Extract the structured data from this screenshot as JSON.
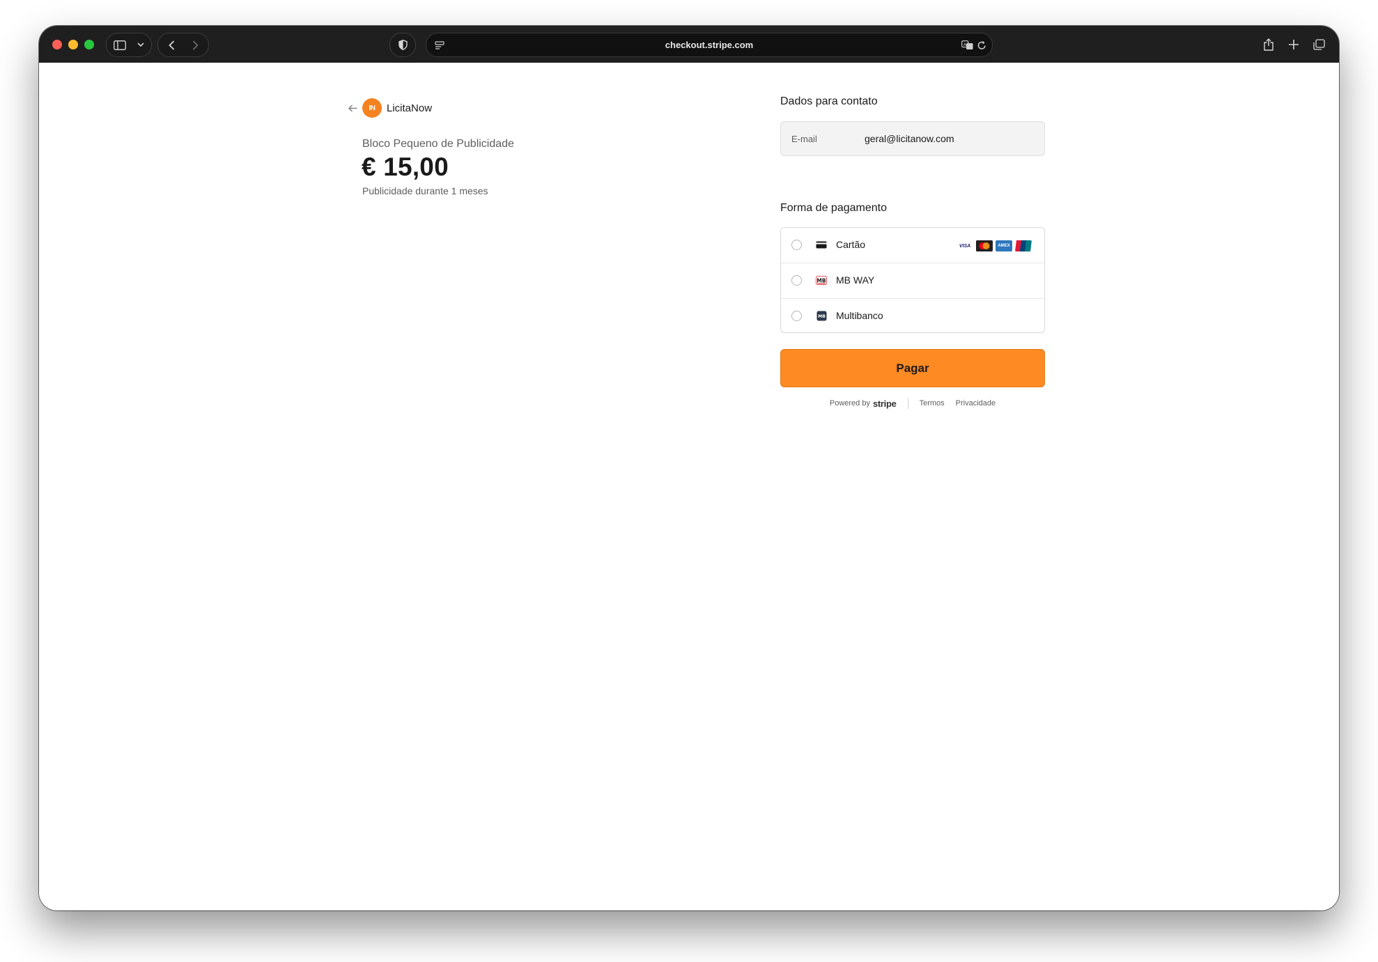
{
  "browser": {
    "url": "checkout.stripe.com"
  },
  "merchant": {
    "name": "LicitaNow",
    "logo_text": "IN"
  },
  "product": {
    "name": "Bloco Pequeno de Publicidade",
    "price": "€ 15,00",
    "description": "Publicidade durante 1 meses"
  },
  "contact": {
    "title": "Dados para contato",
    "email_label": "E-mail",
    "email_value": "geral@licitanow.com"
  },
  "payment": {
    "title": "Forma de pagamento",
    "methods": [
      {
        "label": "Cartão",
        "icon": "card-icon"
      },
      {
        "label": "MB WAY",
        "icon": "mbway-icon"
      },
      {
        "label": "Multibanco",
        "icon": "multibanco-icon"
      }
    ],
    "card_brands": [
      "VISA",
      "mastercard",
      "AMEX",
      "UnionPay"
    ],
    "submit_label": "Pagar"
  },
  "footer": {
    "powered_by": "Powered by",
    "stripe": "stripe",
    "terms": "Termos",
    "privacy": "Privacidade"
  },
  "colors": {
    "accent": "#fd8a23",
    "logo": "#f58220"
  }
}
